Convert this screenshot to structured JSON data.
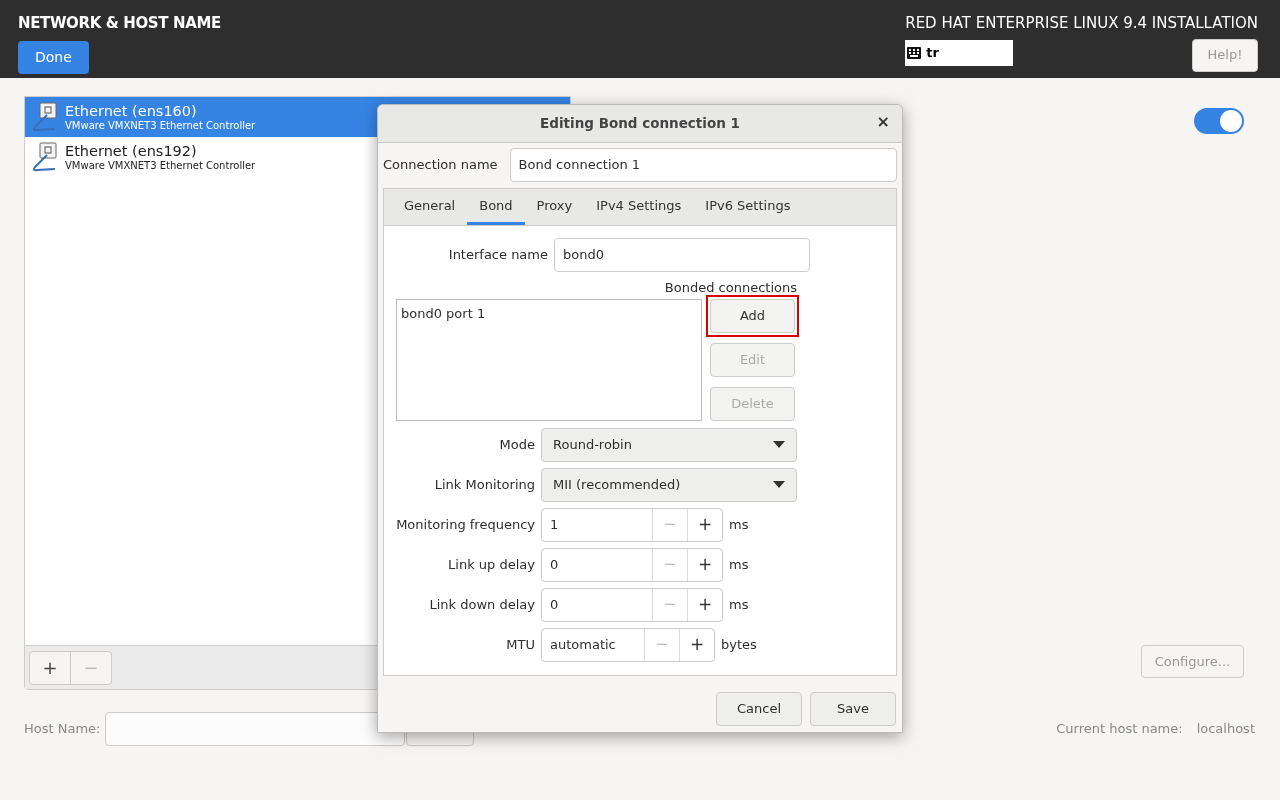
{
  "header": {
    "title": "NETWORK & HOST NAME",
    "done_button": "Done",
    "product": "RED HAT ENTERPRISE LINUX 9.4 INSTALLATION",
    "keyboard_layout": "tr",
    "help_button": "Help!"
  },
  "devices": [
    {
      "name": "Ethernet (ens160)",
      "description": "VMware VMXNET3 Ethernet Controller",
      "selected": true
    },
    {
      "name": "Ethernet (ens192)",
      "description": "VMware VMXNET3 Ethernet Controller",
      "selected": false
    }
  ],
  "list_toolbar": {
    "add": "+",
    "remove": "−",
    "remove_disabled": true
  },
  "device_switch": {
    "on": true
  },
  "configure_button": "Configure...",
  "host_name": {
    "label": "Host Name:"
  },
  "current_host_name": {
    "label": "Current host name:",
    "value": "localhost"
  },
  "dialog": {
    "title": "Editing Bond connection 1",
    "close": "×",
    "connection_name_label": "Connection name",
    "connection_name": "Bond connection 1",
    "tabs": [
      {
        "label": "General",
        "selected": false
      },
      {
        "label": "Bond",
        "selected": true
      },
      {
        "label": "Proxy",
        "selected": false
      },
      {
        "label": "IPv4 Settings",
        "selected": false
      },
      {
        "label": "IPv6 Settings",
        "selected": false
      }
    ],
    "interface_name_label": "Interface name",
    "interface_name": "bond0",
    "bonded_connections_label": "Bonded connections",
    "bonded_connections": [
      "bond0 port 1"
    ],
    "bonded_buttons": [
      {
        "label": "Add",
        "disabled": false,
        "highlighted": true
      },
      {
        "label": "Edit",
        "disabled": true,
        "highlighted": false
      },
      {
        "label": "Delete",
        "disabled": true,
        "highlighted": false
      }
    ],
    "fields": [
      {
        "kind": "dropdown",
        "label": "Mode",
        "value": "Round-robin"
      },
      {
        "kind": "dropdown",
        "label": "Link Monitoring",
        "value": "MII (recommended)"
      },
      {
        "kind": "spin",
        "label": "Monitoring frequency",
        "value": "1",
        "minus": "−",
        "plus": "+",
        "unit": "ms",
        "minus_disabled": true
      },
      {
        "kind": "spin",
        "label": "Link up delay",
        "value": "0",
        "minus": "−",
        "plus": "+",
        "unit": "ms",
        "minus_disabled": true
      },
      {
        "kind": "spin",
        "label": "Link down delay",
        "value": "0",
        "minus": "−",
        "plus": "+",
        "unit": "ms",
        "minus_disabled": true
      },
      {
        "kind": "spin_short",
        "label": "MTU",
        "value": "automatic",
        "minus": "−",
        "plus": "+",
        "unit": "bytes",
        "minus_disabled": true
      }
    ],
    "cancel_button": "Cancel",
    "save_button": "Save"
  }
}
